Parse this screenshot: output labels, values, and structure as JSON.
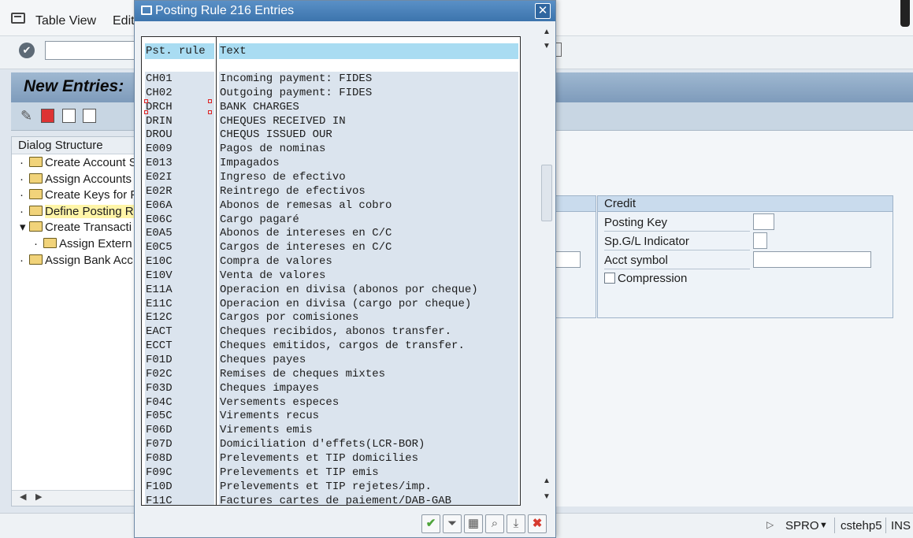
{
  "menubar": {
    "items": [
      "Table View",
      "Edit"
    ]
  },
  "window": {
    "title": "New Entries:"
  },
  "tree": {
    "header": "Dialog Structure",
    "nodes": [
      {
        "label": "Create Account S",
        "bullet": "·",
        "indent": 0,
        "selected": false
      },
      {
        "label": "Assign Accounts",
        "bullet": "·",
        "indent": 0,
        "selected": false
      },
      {
        "label": "Create Keys for P",
        "bullet": "·",
        "indent": 0,
        "selected": false
      },
      {
        "label": "Define Posting R",
        "bullet": "·",
        "indent": 0,
        "selected": true
      },
      {
        "label": "Create Transacti",
        "bullet": "▾",
        "indent": 0,
        "selected": false
      },
      {
        "label": "Assign Extern",
        "bullet": "·",
        "indent": 1,
        "selected": false
      },
      {
        "label": "Assign Bank Acc",
        "bullet": "·",
        "indent": 0,
        "selected": false
      }
    ]
  },
  "credit_group": {
    "title": "Credit",
    "fields": [
      {
        "label": "Posting Key",
        "value": ""
      },
      {
        "label": "Sp.G/L Indicator",
        "value": ""
      },
      {
        "label": "Acct symbol",
        "value": ""
      }
    ],
    "compression_label": "Compression",
    "compression_checked": false
  },
  "dialog": {
    "title": "Posting Rule 216 Entries",
    "columns": {
      "rule": "Pst. rule",
      "text": "Text"
    },
    "rows": [
      {
        "rule": "CH01",
        "text": "Incoming payment: FIDES"
      },
      {
        "rule": "CH02",
        "text": "Outgoing payment: FIDES"
      },
      {
        "rule": "DRCH",
        "text": "BANK CHARGES"
      },
      {
        "rule": "DRIN",
        "text": "CHEQUES RECEIVED IN"
      },
      {
        "rule": "DROU",
        "text": "CHEQUS ISSUED OUR"
      },
      {
        "rule": "E009",
        "text": "Pagos de nominas"
      },
      {
        "rule": "E013",
        "text": "Impagados"
      },
      {
        "rule": "E02I",
        "text": "Ingreso de efectivo"
      },
      {
        "rule": "E02R",
        "text": "Reintrego de efectivos"
      },
      {
        "rule": "E06A",
        "text": "Abonos de remesas al cobro"
      },
      {
        "rule": "E06C",
        "text": "Cargo pagaré"
      },
      {
        "rule": "E0A5",
        "text": "Abonos de intereses en C/C"
      },
      {
        "rule": "E0C5",
        "text": "Cargos de intereses en C/C"
      },
      {
        "rule": "E10C",
        "text": "Compra de valores"
      },
      {
        "rule": "E10V",
        "text": "Venta de valores"
      },
      {
        "rule": "E11A",
        "text": "Operacion en divisa (abonos por cheque)"
      },
      {
        "rule": "E11C",
        "text": "Operacion en divisa (cargo por cheque)"
      },
      {
        "rule": "E12C",
        "text": "Cargos por comisiones"
      },
      {
        "rule": "EACT",
        "text": "Cheques recibidos, abonos transfer."
      },
      {
        "rule": "ECCT",
        "text": "Cheques emitidos, cargos de transfer."
      },
      {
        "rule": "F01D",
        "text": "Cheques payes"
      },
      {
        "rule": "F02C",
        "text": "Remises de cheques mixtes"
      },
      {
        "rule": "F03D",
        "text": "Cheques impayes"
      },
      {
        "rule": "F04C",
        "text": "Versements especes"
      },
      {
        "rule": "F05C",
        "text": "Virements recus"
      },
      {
        "rule": "F06D",
        "text": "Virements emis"
      },
      {
        "rule": "F07D",
        "text": "Domiciliation d'effets(LCR-BOR)"
      },
      {
        "rule": "F08D",
        "text": "Prelevements et TIP domicilies"
      },
      {
        "rule": "F09C",
        "text": "Prelevements et TIP emis"
      },
      {
        "rule": "F10D",
        "text": "Prelevements et TIP rejetes/imp."
      },
      {
        "rule": "F11C",
        "text": "Factures cartes de paiement/DAB-GAB"
      }
    ]
  },
  "statusbar": {
    "program": "SPRO",
    "server": "cstehp5",
    "mode": "INS"
  },
  "colors": {
    "title_bar": "#3c74ad",
    "header_cell": "#a9dcf2",
    "row_cell": "#dbe4ee",
    "ok": "#4ea43a",
    "cancel": "#d63a2e"
  }
}
